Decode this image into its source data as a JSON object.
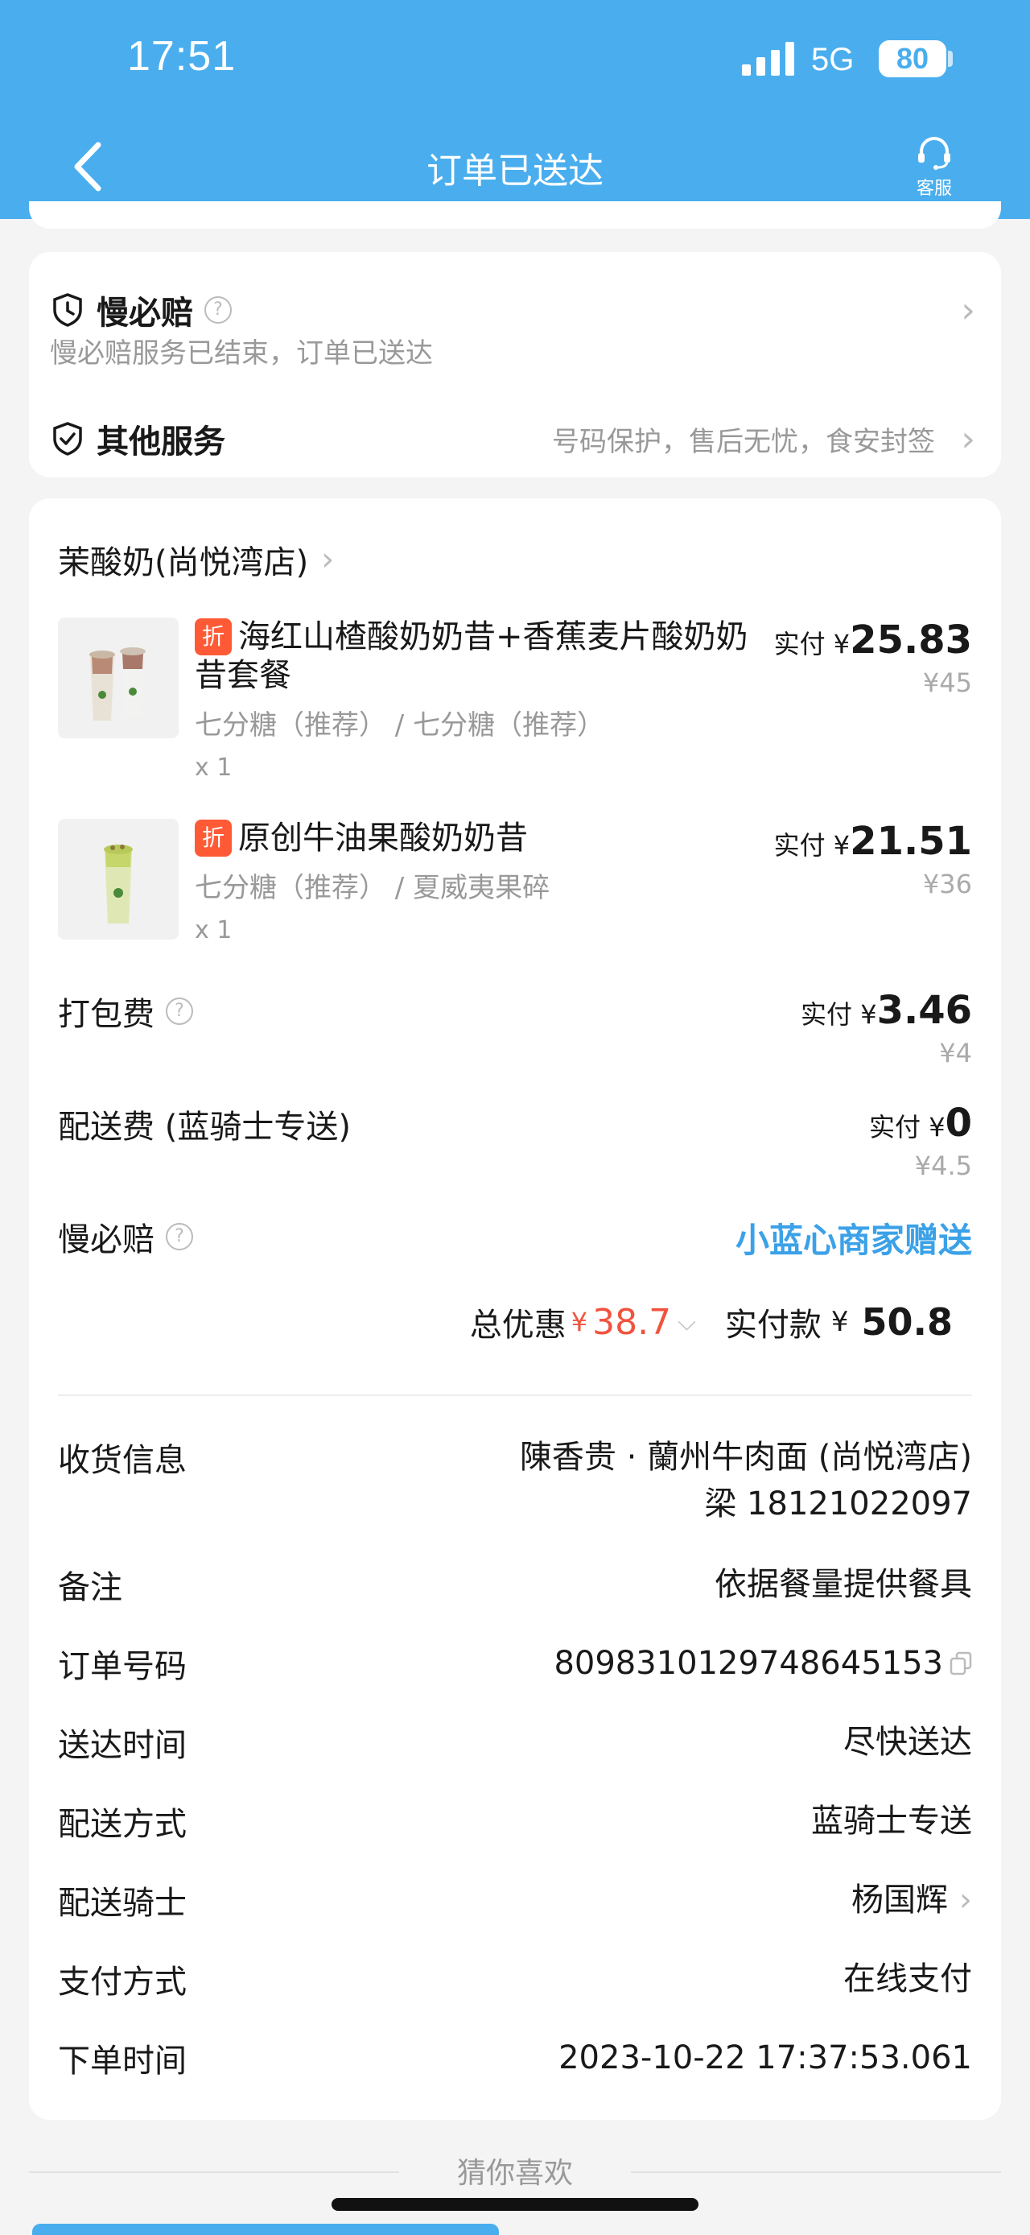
{
  "status_bar": {
    "time": "17:51",
    "network": "5G",
    "battery": "80"
  },
  "nav": {
    "title": "订单已送达",
    "service_label": "客服"
  },
  "services": {
    "slow_pay": {
      "title": "慢必赔",
      "desc": "慢必赔服务已结束，订单已送达"
    },
    "other": {
      "title": "其他服务",
      "desc": "号码保护，售后无忧，食安封签"
    }
  },
  "order": {
    "shop_name": "茉酸奶(尚悦湾店)",
    "items": [
      {
        "badge": "折",
        "name": "海红山楂酸奶奶昔+香蕉麦片酸奶奶昔套餐",
        "spec": "七分糖（推荐） / 七分糖（推荐）",
        "qty": "x 1",
        "paid_label": "实付 ¥",
        "paid": "25.83",
        "original": "¥45"
      },
      {
        "badge": "折",
        "name": "原创牛油果酸奶奶昔",
        "spec": "七分糖（推荐） / 夏威夷果碎",
        "qty": "x 1",
        "paid_label": "实付 ¥",
        "paid": "21.51",
        "original": "¥36"
      }
    ],
    "packing": {
      "label": "打包费",
      "paid_label": "实付 ¥",
      "paid": "3.46",
      "original": "¥4"
    },
    "delivery": {
      "label": "配送费 (蓝骑士专送)",
      "paid_label": "实付 ¥",
      "paid": "0",
      "original": "¥4.5"
    },
    "slow_pay": {
      "label": "慢必赔",
      "value": "小蓝心商家赠送"
    },
    "totals": {
      "discount_label": "总优惠",
      "discount_yen": "¥",
      "discount": "38.7",
      "paid_label": "实付款",
      "paid_yen": "¥",
      "paid": "50.8"
    },
    "info": {
      "receiver": {
        "label": "收货信息",
        "line1": "陳香贵 · 蘭州牛肉面 (尚悦湾店)",
        "line2": "梁 18121022097"
      },
      "note": {
        "label": "备注",
        "value": "依据餐量提供餐具"
      },
      "order_no": {
        "label": "订单号码",
        "value": "8098310129748645153"
      },
      "delivery_time": {
        "label": "送达时间",
        "value": "尽快送达"
      },
      "delivery_method": {
        "label": "配送方式",
        "value": "蓝骑士专送"
      },
      "rider": {
        "label": "配送骑士",
        "value": "杨国辉"
      },
      "payment": {
        "label": "支付方式",
        "value": "在线支付"
      },
      "order_time": {
        "label": "下单时间",
        "value": "2023-10-22 17:37:53.061"
      }
    }
  },
  "recommend_label": "猜你喜欢",
  "colors": {
    "header": "#4aaeee",
    "discount": "#f0533e",
    "gift": "#3ba1e8",
    "badge": "#ff5a36"
  }
}
